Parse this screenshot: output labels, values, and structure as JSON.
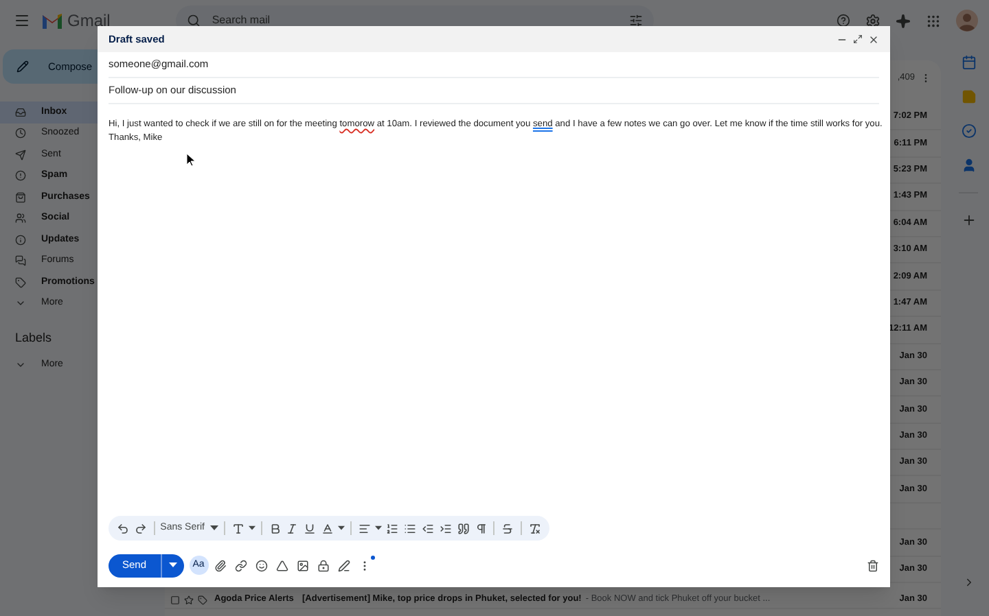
{
  "header": {
    "app_name": "Gmail",
    "search": {
      "placeholder": "Search mail"
    }
  },
  "sidebar": {
    "compose": "Compose",
    "items": [
      {
        "kind": "inbox",
        "label": "Inbox",
        "selected": true,
        "unread": true
      },
      {
        "kind": "snoozed",
        "label": "Snoozed",
        "selected": false,
        "unread": false
      },
      {
        "kind": "sent",
        "label": "Sent",
        "selected": false,
        "unread": false
      },
      {
        "kind": "spam",
        "label": "Spam",
        "selected": false,
        "unread": true
      },
      {
        "kind": "purchases",
        "label": "Purchases",
        "selected": false,
        "unread": true
      },
      {
        "kind": "social",
        "label": "Social",
        "selected": false,
        "unread": true
      },
      {
        "kind": "updates",
        "label": "Updates",
        "selected": false,
        "unread": true
      },
      {
        "kind": "forums",
        "label": "Forums",
        "selected": false,
        "unread": false
      },
      {
        "kind": "promotions",
        "label": "Promotions",
        "selected": false,
        "unread": true
      },
      {
        "kind": "more",
        "label": "More",
        "selected": false,
        "unread": false
      }
    ],
    "labels_heading": "Labels",
    "labels_more": "More"
  },
  "mail_list": {
    "count": ",409",
    "rows": [
      {
        "kind": "date",
        "date": "7:02 PM"
      },
      {
        "kind": "date",
        "date": "6:11 PM"
      },
      {
        "kind": "date",
        "date": "5:23 PM"
      },
      {
        "kind": "date",
        "date": "1:43 PM"
      },
      {
        "kind": "date",
        "date": "6:04 AM"
      },
      {
        "kind": "date",
        "date": "3:10 AM"
      },
      {
        "kind": "date",
        "date": "2:09 AM"
      },
      {
        "kind": "date",
        "date": "1:47 AM"
      },
      {
        "kind": "date",
        "date": "12:11 AM"
      },
      {
        "kind": "date",
        "date": "Jan 30"
      },
      {
        "kind": "date",
        "date": "Jan 30"
      },
      {
        "kind": "date",
        "date": "Jan 30"
      },
      {
        "kind": "date",
        "date": "Jan 30"
      },
      {
        "kind": "date",
        "date": "Jan 30"
      },
      {
        "kind": "date",
        "date": "Jan 30"
      },
      {
        "kind": "blank"
      },
      {
        "kind": "date",
        "date": "Jan 30"
      },
      {
        "kind": "date",
        "date": "Jan 30"
      },
      {
        "kind": "message",
        "checked": false,
        "sender": "Agoda Price Alerts",
        "subject": "[Advertisement] Mike, top price drops in Phuket, selected for you!",
        "snippet": "- Book NOW and tick Phuket off your bucket ...",
        "date": "Jan 30"
      }
    ]
  },
  "compose": {
    "title": "Draft saved",
    "to": "someone@gmail.com",
    "subject": "Follow-up on our discussion",
    "body": [
      {
        "segments": [
          {
            "kind": "plain",
            "text": "Hi, I just wanted to check if we are still on for the meeting "
          },
          {
            "kind": "spelling",
            "text": "tomorow"
          },
          {
            "kind": "plain",
            "text": " at 10am. I reviewed the document you "
          },
          {
            "kind": "grammar",
            "text": "send"
          },
          {
            "kind": "plain",
            "text": " and I have a few notes we can go over. Let me know if the time still works for you."
          }
        ]
      },
      {
        "segments": [
          {
            "kind": "plain",
            "text": "Thanks, Mike"
          }
        ]
      }
    ],
    "font": "Sans Serif",
    "format_options": {
      "label": "Aa",
      "selected": true
    },
    "send": "Send",
    "notification_dot": true
  }
}
